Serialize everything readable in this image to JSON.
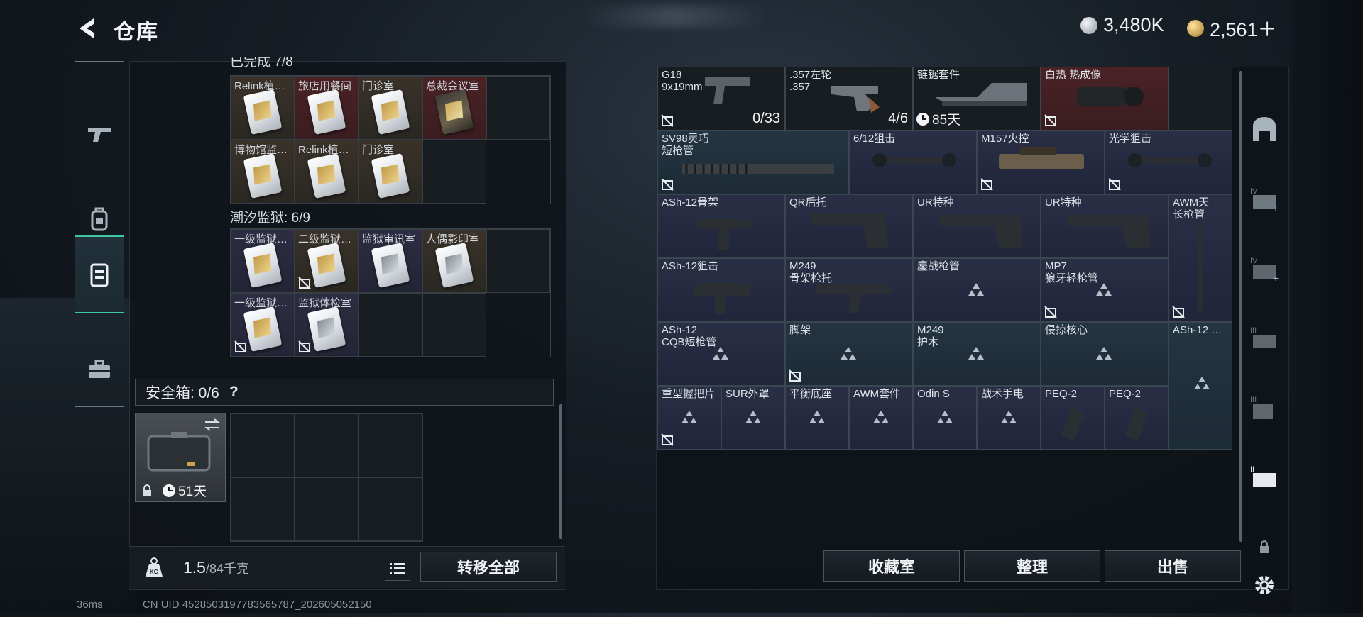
{
  "header": {
    "title": "仓库",
    "currency": [
      {
        "icon": "silver-coin-icon",
        "value": "3,480K"
      },
      {
        "icon": "gold-coin-icon",
        "value": "2,561＋"
      }
    ]
  },
  "left_rail": [
    "weapon-tab-icon",
    "backpack-tab-icon",
    "keycard-tab-icon",
    "toolbox-tab-icon"
  ],
  "sections": {
    "cut_title": "已完成 7/8",
    "tide_prison": {
      "title": "潮汐监狱: 6/9",
      "items": [
        {
          "label": "一级监狱…",
          "style": "c-purple",
          "card": "gold"
        },
        {
          "label": "二级监狱…",
          "style": "c-brown",
          "card": "gold",
          "locked": true
        },
        {
          "label": "监狱审讯室",
          "style": "c-purple",
          "card": "silver"
        },
        {
          "label": "人偶影印室",
          "style": "c-brown",
          "card": "silver"
        },
        {
          "label": "一级监狱…",
          "style": "c-purple",
          "card": "gold",
          "locked": true
        },
        {
          "label": "监狱体检室",
          "style": "c-purple",
          "card": "silver",
          "locked": true
        }
      ]
    },
    "top_items": [
      {
        "label": "Relink植…",
        "style": "c-brown",
        "card": "white"
      },
      {
        "label": "旅店用餐间",
        "style": "c-red",
        "card": "white"
      },
      {
        "label": "门诊室",
        "style": "c-brown",
        "card": "white"
      },
      {
        "label": "总裁会议室",
        "style": "c-red",
        "card": "gold"
      },
      {
        "label": "博物馆监…",
        "style": "c-brown",
        "card": "white"
      },
      {
        "label": "Relink植…",
        "style": "c-brown",
        "card": "white"
      },
      {
        "label": "门诊室",
        "style": "c-brown",
        "card": "white"
      }
    ]
  },
  "safe_box": {
    "label": "安全箱: 0/6",
    "help": "?",
    "days": "51天"
  },
  "weight": {
    "current": "1.5",
    "unit": "/84千克"
  },
  "buttons": {
    "transfer_all": "转移全部",
    "collection": "收藏室",
    "organize": "整理",
    "sell": "出售"
  },
  "stash_items": [
    {
      "label": "G18\n9x19mm",
      "count": "0/33",
      "locked": true
    },
    {
      "label": ".357左轮\n.357",
      "count": "4/6"
    },
    {
      "label": "链锯套件",
      "timer": "85天"
    },
    {
      "label": "白热 热成像",
      "locked": true
    },
    {
      "label": "SV98灵巧\n短枪管",
      "locked": true
    },
    {
      "label": "6/12狙击"
    },
    {
      "label": "M157火控",
      "locked": true
    },
    {
      "label": "光学狙击",
      "locked": true
    },
    {
      "label": "ASh-12骨架"
    },
    {
      "label": "QR后托"
    },
    {
      "label": "UR特种"
    },
    {
      "label": "UR特种"
    },
    {
      "label": "AWM天\n长枪管",
      "locked": true
    },
    {
      "label": "ASh-12狙击"
    },
    {
      "label": "M249\n骨架枪托"
    },
    {
      "label": "鏖战枪管"
    },
    {
      "label": "MP7\n狼牙轻枪管",
      "locked": true
    },
    {
      "label": "ASh-12\nCQB短枪管"
    },
    {
      "label": "脚架",
      "locked": true
    },
    {
      "label": "M249\n护木"
    },
    {
      "label": "侵掠核心"
    },
    {
      "label": "ASh-12 …"
    },
    {
      "label": "重型握把片",
      "locked": true
    },
    {
      "label": "SUR外罩"
    },
    {
      "label": "平衡底座"
    },
    {
      "label": "AWM套件"
    },
    {
      "label": "Odin S"
    },
    {
      "label": "战术手电"
    },
    {
      "label": "PEQ-2"
    },
    {
      "label": "PEQ-2"
    }
  ],
  "right_rail": [
    "base-tab-icon",
    "storage-iv-1-icon",
    "storage-iv-2-icon",
    "storage-iii-1-icon",
    "storage-iii-2-icon",
    "storage-ii-icon",
    "lock-icon",
    "settings-icon"
  ],
  "status": {
    "ping": "36ms",
    "uid": "CN UID 4528503197783565787_202605052150"
  }
}
